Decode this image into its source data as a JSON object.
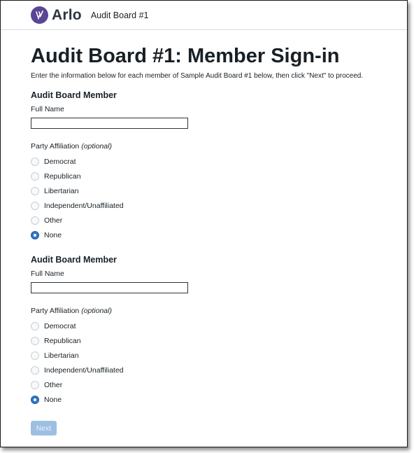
{
  "header": {
    "logo_text": "Arlo",
    "audit_board_name": "Audit Board #1"
  },
  "page": {
    "title": "Audit Board #1: Member Sign-in",
    "instructions": "Enter the information below for each member of Sample Audit Board #1 below, then click \"Next\" to proceed."
  },
  "members": [
    {
      "heading": "Audit Board Member",
      "full_name_label": "Full Name",
      "full_name_value": "",
      "party_label": "Party Affiliation",
      "party_optional": "(optional)",
      "selected": "None",
      "options": [
        "Democrat",
        "Republican",
        "Libertarian",
        "Independent/Unaffiliated",
        "Other",
        "None"
      ]
    },
    {
      "heading": "Audit Board Member",
      "full_name_label": "Full Name",
      "full_name_value": "",
      "party_label": "Party Affiliation",
      "party_optional": "(optional)",
      "selected": "None",
      "options": [
        "Democrat",
        "Republican",
        "Libertarian",
        "Independent/Unaffiliated",
        "Other",
        "None"
      ]
    }
  ],
  "next_button": {
    "label": "Next",
    "disabled": true
  },
  "colors": {
    "brand": "#5b4596",
    "radio_checked": "#2f78c4",
    "button_disabled": "#9dc0e2"
  }
}
